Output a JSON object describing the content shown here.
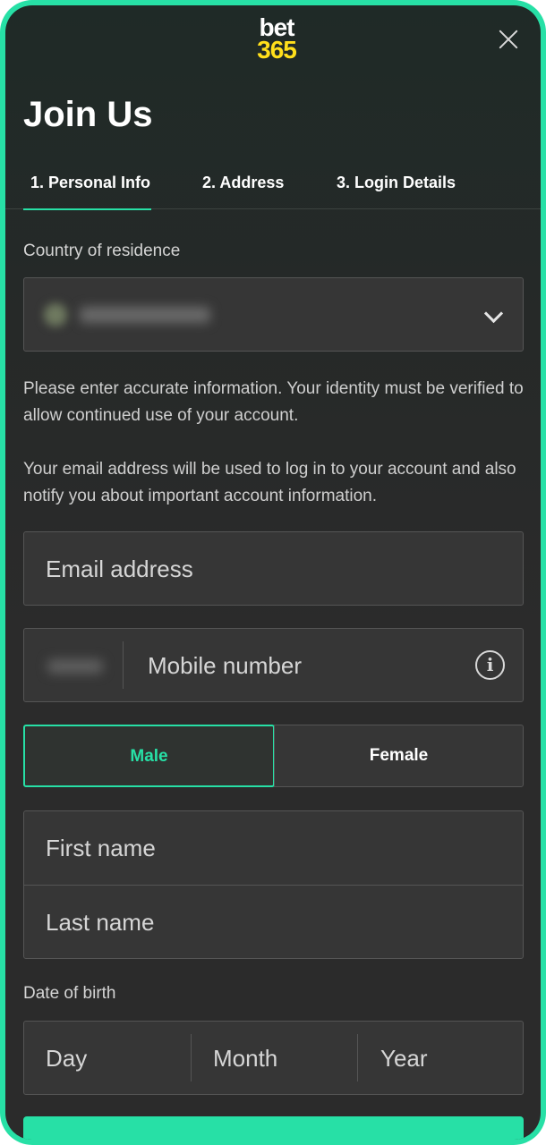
{
  "logo": {
    "line1": "bet",
    "line2": "365"
  },
  "title": "Join Us",
  "tabs": [
    {
      "label": "1.  Personal Info",
      "active": true
    },
    {
      "label": "2.  Address",
      "active": false
    },
    {
      "label": "3.  Login Details",
      "active": false
    }
  ],
  "country": {
    "label": "Country of residence"
  },
  "info": {
    "identity": "Please enter accurate information. Your identity must be verified to allow continued use of your account.",
    "email": "Your email address will be used to log in to your account and also notify you about important account information."
  },
  "fields": {
    "email_placeholder": "Email address",
    "mobile_placeholder": "Mobile number",
    "first_name_placeholder": "First name",
    "last_name_placeholder": "Last name"
  },
  "gender": {
    "male": "Male",
    "female": "Female",
    "selected": "Male"
  },
  "dob": {
    "label": "Date of birth",
    "day": "Day",
    "month": "Month",
    "year": "Year"
  },
  "icons": {
    "close": "close-icon",
    "chevron": "chevron-down-icon",
    "info": "info-icon",
    "info_glyph": "i"
  },
  "colors": {
    "accent": "#27e0a6",
    "logo_yellow": "#ffdf1b",
    "background": "#2b2b2b",
    "field": "#363636"
  }
}
